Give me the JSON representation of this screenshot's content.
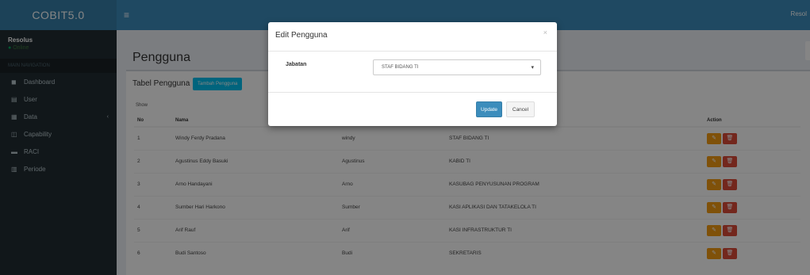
{
  "app": {
    "logo": "COBIT5.0",
    "top_right": "Resol"
  },
  "sidebar": {
    "user": {
      "name": "Resolus",
      "status": "Online"
    },
    "header": "MAIN NAVIGATION",
    "items": [
      {
        "icon": "dashboard-icon",
        "glyph": "◼",
        "label": "Dashboard"
      },
      {
        "icon": "file-icon",
        "glyph": "▤",
        "label": "User"
      },
      {
        "icon": "table-icon",
        "glyph": "▦",
        "label": "Data",
        "chevron": "‹"
      },
      {
        "icon": "chart-icon",
        "glyph": "◫",
        "label": "Capability"
      },
      {
        "icon": "list-icon",
        "glyph": "▬",
        "label": "RACI"
      },
      {
        "icon": "gear-icon",
        "glyph": "▥",
        "label": "Periode"
      }
    ]
  },
  "page": {
    "title": "Pengguna",
    "box_title": "Tabel Pengguna",
    "add_button": "Tambah Pengguna",
    "show_label": "Show"
  },
  "table": {
    "headers": [
      "No",
      "Nama",
      "",
      "",
      "Action"
    ],
    "rows": [
      {
        "no": "1",
        "name": "Windy Ferdy Pradana",
        "user": "windy",
        "jabatan": "STAF BIDANG TI"
      },
      {
        "no": "2",
        "name": "Agustinus Eddy Basuki",
        "user": "Agustinus",
        "jabatan": "KABID TI"
      },
      {
        "no": "3",
        "name": "Arno Handayani",
        "user": "Arno",
        "jabatan": "KASUBAG PENYUSUNAN PROGRAM"
      },
      {
        "no": "4",
        "name": "Sumber Hari Harkono",
        "user": "Sumber",
        "jabatan": "KASI APLIKASI DAN TATAKELOLA TI"
      },
      {
        "no": "5",
        "name": "Arif Rauf",
        "user": "Arif",
        "jabatan": "KASI INFRASTRUKTUR TI"
      },
      {
        "no": "6",
        "name": "Budi Santoso",
        "user": "Budi",
        "jabatan": "SEKRETARIS"
      }
    ],
    "edit_glyph": "✎",
    "delete_glyph": "🗑"
  },
  "modal": {
    "title": "Edit Pengguna",
    "close": "×",
    "field_label": "Jabatan",
    "select_value": "STAF BIDANG TI",
    "select_caret": "▾",
    "update_label": "Update",
    "cancel_label": "Cancel"
  },
  "colors": {
    "header": "#3c8dbc",
    "sidebar": "#222d32",
    "edit": "#f39c12",
    "delete": "#dd4b39",
    "add_button": "#00c0ef"
  }
}
